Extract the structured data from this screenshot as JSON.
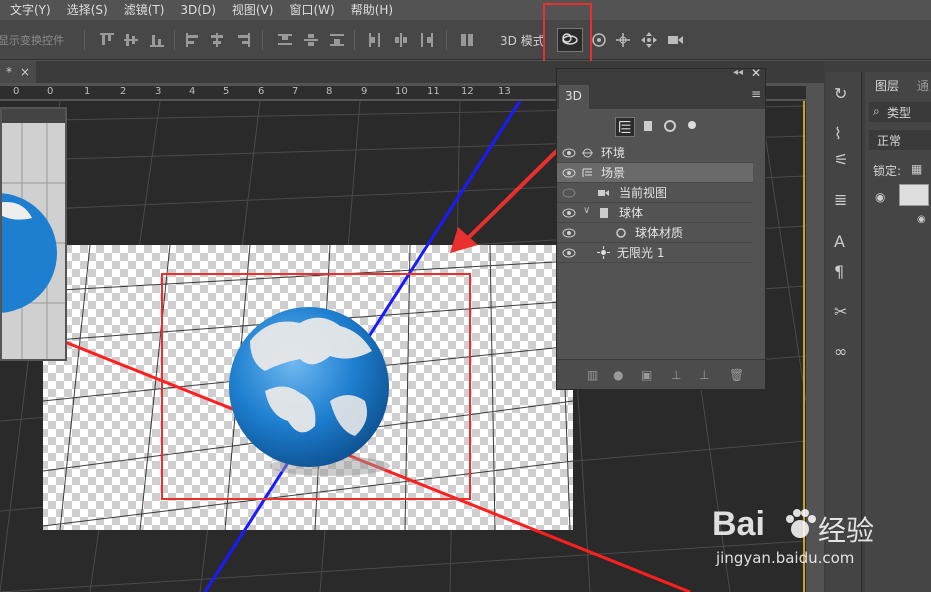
{
  "menubar": {
    "items": [
      "文字(Y)",
      "选择(S)",
      "滤镜(T)",
      "3D(D)",
      "视图(V)",
      "窗口(W)",
      "帮助(H)"
    ]
  },
  "optionsbar": {
    "show_transform_label": "显示变换控件",
    "mode_label": "3D 模式"
  },
  "document": {
    "tab_close": "×",
    "tab_marker": "*"
  },
  "ruler": {
    "ticks": [
      "0",
      "1",
      "0",
      "1",
      "2",
      "3",
      "4",
      "5",
      "6",
      "7",
      "8",
      "9",
      "10",
      "11",
      "12",
      "13"
    ]
  },
  "panel3d": {
    "tab_label": "3D",
    "rows": [
      {
        "label": "环境",
        "icon": "environment-icon",
        "selected": false
      },
      {
        "label": "场景",
        "icon": "scene-icon",
        "selected": true
      },
      {
        "label": "当前视图",
        "icon": "camera-icon",
        "selected": false
      },
      {
        "label": "球体",
        "icon": "mesh-icon",
        "selected": false
      },
      {
        "label": "球体材质",
        "icon": "material-icon",
        "selected": false
      },
      {
        "label": "无限光 1",
        "icon": "light-icon",
        "selected": false
      }
    ]
  },
  "layers": {
    "tab_label": "图层",
    "tab2_label": "通",
    "filter_label": "类型",
    "blend_mode": "正常",
    "lock_label": "锁定:"
  },
  "watermark": {
    "brand_text": "Bai",
    "brand_text2": "经验",
    "url": "jingyan.baidu.com"
  },
  "colors": {
    "annotation": "#e8302f",
    "axis_x": "#ff1f1f",
    "axis_z": "#1a1aff",
    "globe_ocean": "#1e7fd0"
  }
}
